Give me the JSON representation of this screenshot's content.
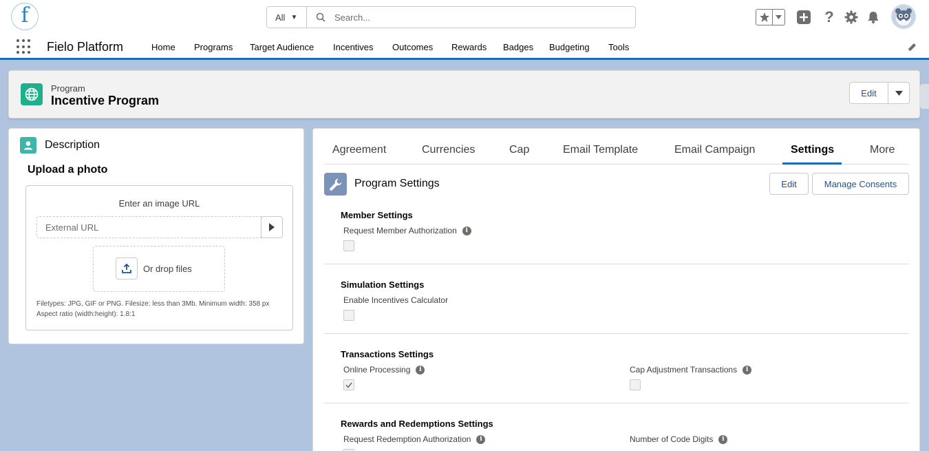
{
  "header": {
    "logo_letter": "f",
    "search_scope": "All",
    "search_placeholder": "Search..."
  },
  "nav": {
    "app_name": "Fielo Platform",
    "items": [
      "Home",
      "Programs",
      "Target Audience",
      "Incentives",
      "Outcomes",
      "Rewards",
      "Badges",
      "Budgeting",
      "Tools"
    ]
  },
  "record": {
    "type_label": "Program",
    "name": "Incentive Program",
    "edit_label": "Edit"
  },
  "description_card": {
    "title": "Description",
    "upload_title": "Upload a photo",
    "enter_url_label": "Enter an image URL",
    "url_placeholder": "External URL",
    "drop_label": "Or drop files",
    "hint_line1": "Filetypes: JPG, GIF or PNG. Filesize: less than 3Mb. Minimum width: 358 px",
    "hint_line2": "Aspect ratio (width:height): 1.8:1"
  },
  "tabs": {
    "items": [
      "Agreement",
      "Currencies",
      "Cap",
      "Email Template",
      "Email Campaign",
      "Settings",
      "More"
    ],
    "active": "Settings"
  },
  "settings": {
    "title": "Program Settings",
    "edit_label": "Edit",
    "manage_consents_label": "Manage Consents",
    "sections": [
      {
        "title": "Member Settings",
        "fields": [
          {
            "label": "Request Member Authorization",
            "checked": false
          }
        ]
      },
      {
        "title": "Simulation Settings",
        "fields": [
          {
            "label": "Enable Incentives Calculator",
            "checked": false
          }
        ]
      },
      {
        "title": "Transactions Settings",
        "fields": [
          {
            "label": "Online Processing",
            "checked": true
          },
          {
            "label": "Cap Adjustment Transactions",
            "checked": false
          }
        ]
      },
      {
        "title": "Rewards and Redemptions Settings",
        "fields": [
          {
            "label": "Request Redemption Authorization",
            "checked": false
          },
          {
            "label": "Number of Code Digits",
            "checked": false
          }
        ]
      }
    ]
  },
  "colors": {
    "brand_blue": "#1b6bb5",
    "link_blue": "#1b5297",
    "record_icon": "#1eb08a",
    "page_bg": "#b0c4df"
  }
}
